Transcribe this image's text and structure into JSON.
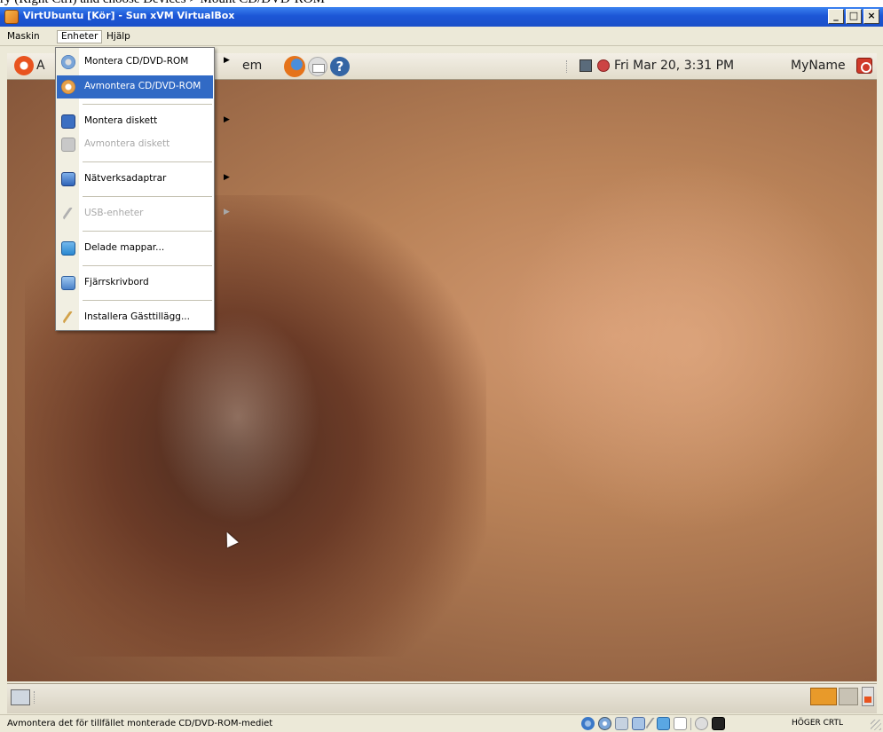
{
  "window": {
    "title": "VirtUbuntu [Kör] - Sun xVM VirtualBox",
    "top_strip_text": "ry (Right Ctrl) and choose Devices > Mount CD/DVD-ROM",
    "buttons": [
      "_",
      "□",
      "×"
    ]
  },
  "menubar": {
    "items": [
      "Maskin",
      "Enheter",
      "Hjälp"
    ]
  },
  "devices_menu": {
    "items": [
      {
        "label": "Montera CD/DVD-ROM",
        "icon": "cd-mount-icon",
        "submenu": true,
        "state": "normal"
      },
      {
        "label": "Avmontera CD/DVD-ROM",
        "icon": "cd-unmount-icon",
        "submenu": false,
        "state": "highlighted"
      },
      {
        "label": "Montera diskett",
        "icon": "floppy-icon",
        "submenu": true,
        "state": "normal"
      },
      {
        "label": "Avmontera diskett",
        "icon": "floppy-unmount-icon",
        "submenu": false,
        "state": "disabled"
      },
      {
        "label": "Nätverksadaptrar",
        "icon": "network-adapter-icon",
        "submenu": true,
        "state": "normal"
      },
      {
        "label": "USB-enheter",
        "icon": "usb-icon",
        "submenu": true,
        "state": "disabled"
      },
      {
        "label": "Delade mappar...",
        "icon": "shared-folder-icon",
        "submenu": false,
        "state": "normal"
      },
      {
        "label": "Fjärrskrivbord",
        "icon": "remote-desktop-icon",
        "submenu": false,
        "state": "normal"
      },
      {
        "label": "Installera Gästtillägg...",
        "icon": "guest-additions-icon",
        "submenu": false,
        "state": "normal"
      }
    ],
    "submenu_arrow": "▶"
  },
  "guest_panel": {
    "applications_partial": "A",
    "system_partial": "em",
    "clock": "Fri Mar 20,  3:31 PM",
    "user": "MyName",
    "help_glyph": "?"
  },
  "statusbar": {
    "message": "Avmontera det för tillfället monterade CD/DVD-ROM-mediet",
    "host_key": "HÖGER CRTL"
  }
}
